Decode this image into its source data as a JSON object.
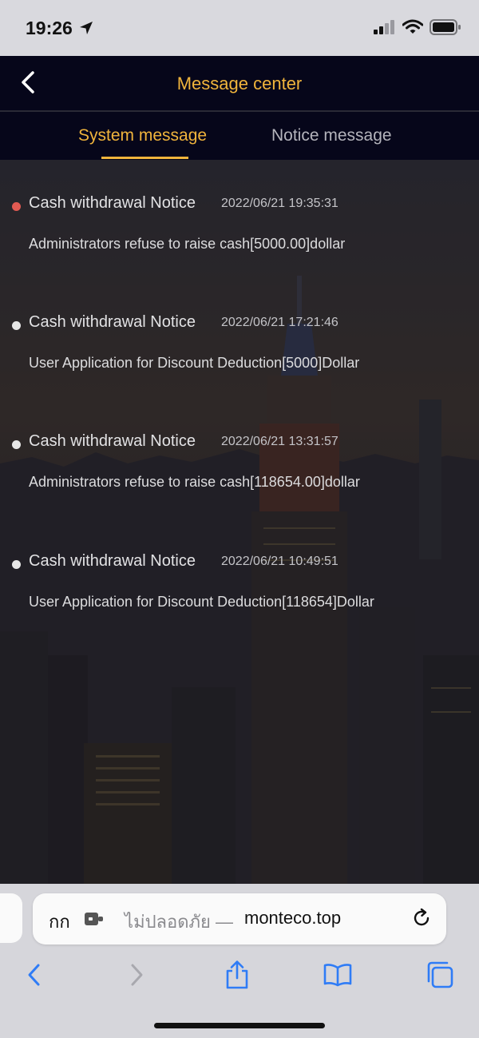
{
  "status_bar": {
    "time": "19:26"
  },
  "header": {
    "title": "Message center"
  },
  "tabs": [
    {
      "label": "System message",
      "active": true
    },
    {
      "label": "Notice message",
      "active": false
    }
  ],
  "messages": [
    {
      "title": "Cash withdrawal Notice",
      "time": "2022/06/21 19:35:31",
      "body": "Administrators refuse to raise cash[5000.00]dollar",
      "unread": true
    },
    {
      "title": "Cash withdrawal Notice",
      "time": "2022/06/21 17:21:46",
      "body": "User Application for Discount Deduction[5000]Dollar",
      "unread": false
    },
    {
      "title": "Cash withdrawal Notice",
      "time": "2022/06/21 13:31:57",
      "body": "Administrators refuse to raise cash[118654.00]dollar",
      "unread": false
    },
    {
      "title": "Cash withdrawal Notice",
      "time": "2022/06/21 10:49:51",
      "body": "User Application for Discount Deduction[118654]Dollar",
      "unread": false
    }
  ],
  "browser": {
    "text_size_label": "กก",
    "address_prefix": "ไม่ปลอดภัย —",
    "address_domain": "monteco.top"
  },
  "colors": {
    "accent": "#f0b43c",
    "header_bg": "#06061a",
    "unread_dot": "#e25a52",
    "read_dot": "#e6e6e6",
    "ios_blue": "#2f7cf6"
  },
  "icons": [
    "location-arrow-icon",
    "cellular-signal-icon",
    "wifi-icon",
    "battery-icon",
    "chevron-left-icon",
    "extension-icon",
    "reload-icon",
    "back-arrow-icon",
    "forward-arrow-icon",
    "share-icon",
    "bookmarks-icon",
    "tabs-icon"
  ]
}
